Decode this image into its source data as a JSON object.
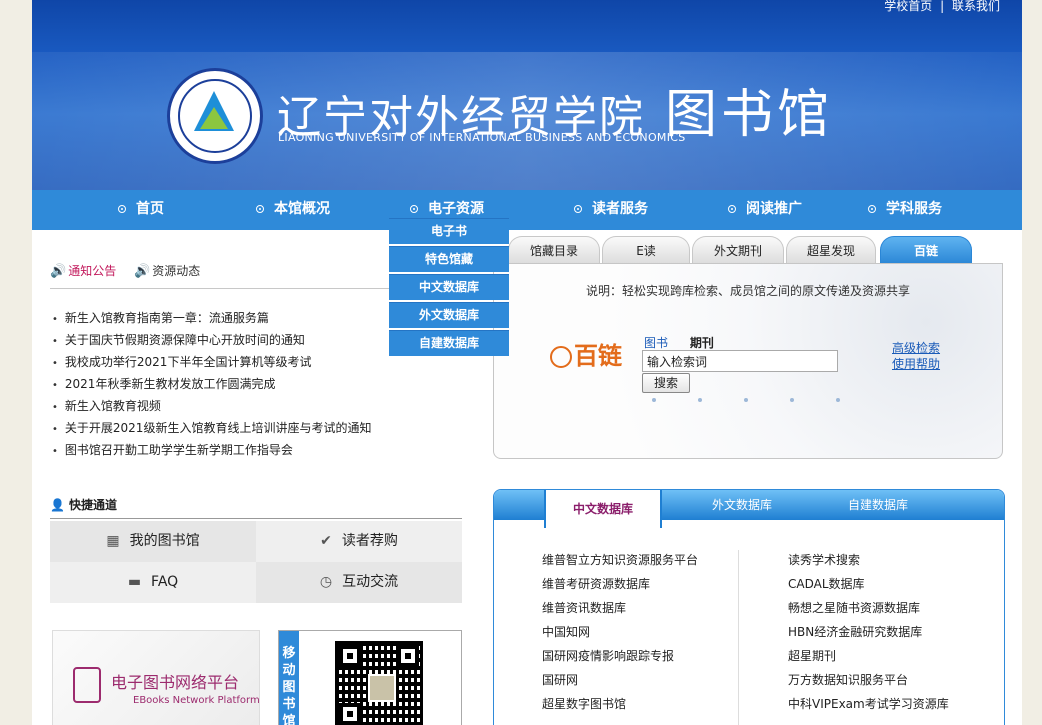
{
  "header": {
    "top_links": [
      "学校首页",
      "|",
      "联系我们"
    ],
    "school_name": "辽宁对外经贸学院",
    "library_name": "图书馆",
    "school_name_en": "LIAONING UNIVERSITY OF INTERNATIONAL BUSINESS AND ECONOMICS"
  },
  "nav": {
    "items": [
      "首页",
      "本馆概况",
      "电子资源",
      "读者服务",
      "阅读推广",
      "学科服务"
    ],
    "dropdown": [
      "电子书",
      "特色馆藏",
      "中文数据库",
      "外文数据库",
      "自建数据库"
    ]
  },
  "notices": {
    "tabs": [
      "通知公告",
      "资源动态"
    ],
    "items": [
      "新生入馆教育指南第一章：流通服务篇",
      "关于国庆节假期资源保障中心开放时间的通知",
      "我校成功举行2021下半年全国计算机等级考试",
      "2021年秋季新生教材发放工作圆满完成",
      "新生入馆教育视频",
      "关于开展2021级新生入馆教育线上培训讲座与考试的通知",
      "图书馆召开勤工助学学生新学期工作指导会"
    ]
  },
  "quick": {
    "title": "快捷通道",
    "items": [
      "我的图书馆",
      "读者荐购",
      "FAQ",
      "互动交流"
    ]
  },
  "banners": {
    "ebook_cn": "电子图书网络平台",
    "ebook_en": "EBooks Network Platform",
    "mobile_label": "移动图书馆"
  },
  "search": {
    "tabs": [
      "馆藏目录",
      "E读",
      "外文期刊",
      "超星发现",
      "百链"
    ],
    "description": "说明：轻松实现跨库检索、成员馆之间的原文传递及资源共享",
    "logo_text": "百链",
    "categories": [
      "图书",
      "期刊"
    ],
    "input_value": "输入检索词",
    "button_label": "搜索",
    "links": [
      "高级检索",
      "使用帮助"
    ]
  },
  "databases": {
    "tabs": [
      "中文数据库",
      "外文数据库",
      "自建数据库"
    ],
    "left": [
      "维普智立方知识资源服务平台",
      "维普考研资源数据库",
      "维普资讯数据库",
      "中国知网",
      "国研网疫情影响跟踪专报",
      "国研网",
      "超星数字图书馆"
    ],
    "right": [
      "读秀学术搜索",
      "CADAL数据库",
      "畅想之星随书资源数据库",
      "HBN经济金融研究数据库",
      "超星期刊",
      "万方数据知识服务平台",
      "中科VIPExam考试学习资源库"
    ]
  },
  "colors": {
    "header_blue": "#1a5bc2",
    "nav_blue": "#2f8ad9",
    "accent_magenta": "#c2185b",
    "link_blue": "#1a5bb8",
    "bailian_orange": "#e36c1b"
  }
}
